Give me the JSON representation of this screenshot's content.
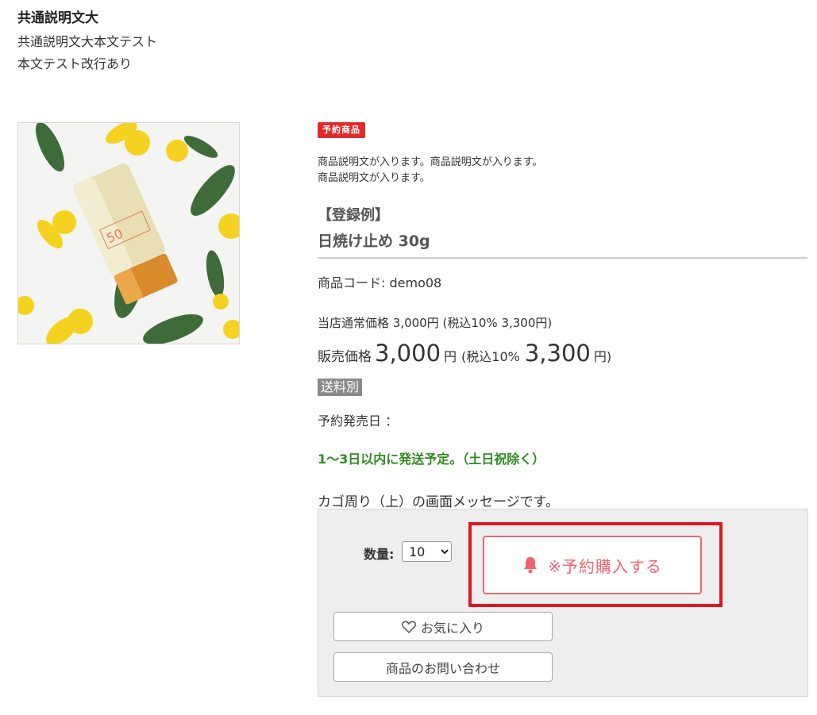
{
  "header": {
    "title": "共通説明文大",
    "line1": "共通説明文大本文テスト",
    "line2": "本文テスト改行あり"
  },
  "product": {
    "badge": "予約商品",
    "desc_line1": "商品説明文が入ります。商品説明文が入ります。",
    "desc_line2": "商品説明文が入ります。",
    "register_example": "【登録例】",
    "name": "日焼け止め 30g",
    "code_label": "商品コード:",
    "code_value": "demo08",
    "regular_price": "当店通常価格 3,000円 (税込10% 3,300円)",
    "sale_label": "販売価格",
    "sale_price": "3,000",
    "yen": "円",
    "tax_label": "(税込10%",
    "tax_price": "3,300",
    "yen_close": "円)",
    "shipping": "送料別",
    "release_date": "予約発売日 ：",
    "shipping_note": "1〜3日以内に発送予定。（土日祝除く）"
  },
  "cart": {
    "message": "カゴ周り（上）の画面メッセージです。",
    "quantity_label": "数量:",
    "quantity_value": "10",
    "reserve_button": "※予約購入する",
    "favorite_button": "お気に入り",
    "inquiry_button": "商品のお問い合わせ"
  },
  "colors": {
    "badge": "#e02b2b",
    "reserve": "#f06470",
    "highlight": "#e0161e",
    "shipping_note": "#2e8b1f"
  }
}
